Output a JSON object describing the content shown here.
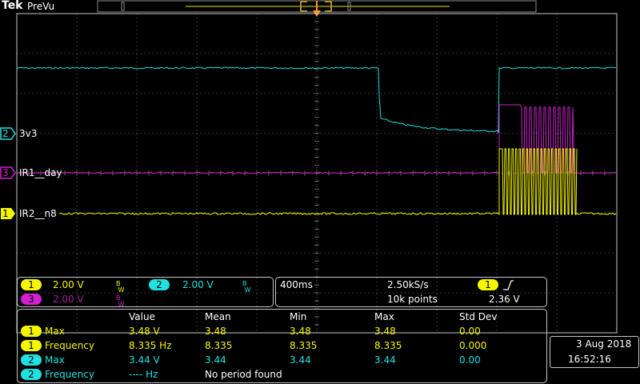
{
  "header": {
    "brand": "Tek",
    "mode": "PreVu"
  },
  "channels": [
    {
      "num": "1",
      "label": "IR2__n8",
      "color": "#f6f600"
    },
    {
      "num": "2",
      "label": "3v3",
      "color": "#20e0e0"
    },
    {
      "num": "3",
      "label": "IR1__day",
      "color": "#d020d0"
    }
  ],
  "vertical": {
    "ch1": {
      "num": "1",
      "scale": "2.00 V",
      "bw": "B W"
    },
    "ch2": {
      "num": "2",
      "scale": "2.00 V",
      "bw": "B W"
    },
    "ch3": {
      "num": "3",
      "scale": "2.00 V",
      "bw": "B W"
    }
  },
  "horizontal": {
    "timebase": "400ms",
    "sample_rate": "2.50kS/s",
    "record_length": "10k points"
  },
  "trigger": {
    "source": "1",
    "slope_icon": "rising-edge",
    "level": "2.36 V"
  },
  "measurements": {
    "headers": [
      "Value",
      "Mean",
      "Min",
      "Max",
      "Std Dev"
    ],
    "rows": [
      {
        "ch": "1",
        "name": "Max",
        "value": "3.48 V",
        "mean": "3.48",
        "min": "3.48",
        "max": "3.48",
        "std": "0.00"
      },
      {
        "ch": "1",
        "name": "Frequency",
        "value": "8.335 Hz",
        "mean": "8.335",
        "min": "8.335",
        "max": "8.335",
        "std": "0.000"
      },
      {
        "ch": "2",
        "name": "Max",
        "value": "3.44 V",
        "mean": "3.44",
        "min": "3.44",
        "max": "3.44",
        "std": "0.00"
      },
      {
        "ch": "2",
        "name": "Frequency",
        "value": "---- Hz",
        "mean": "No period found",
        "min": "",
        "max": "",
        "std": ""
      }
    ]
  },
  "datetime": {
    "date": "3 Aug 2018",
    "time": "16:52:16"
  },
  "colors": {
    "ch1": "#f6f600",
    "ch2": "#20e0e0",
    "ch3": "#d020d0",
    "trigger": "#ff9a20",
    "grid": "#6a6a6a",
    "frame": "#c8c8c8"
  }
}
